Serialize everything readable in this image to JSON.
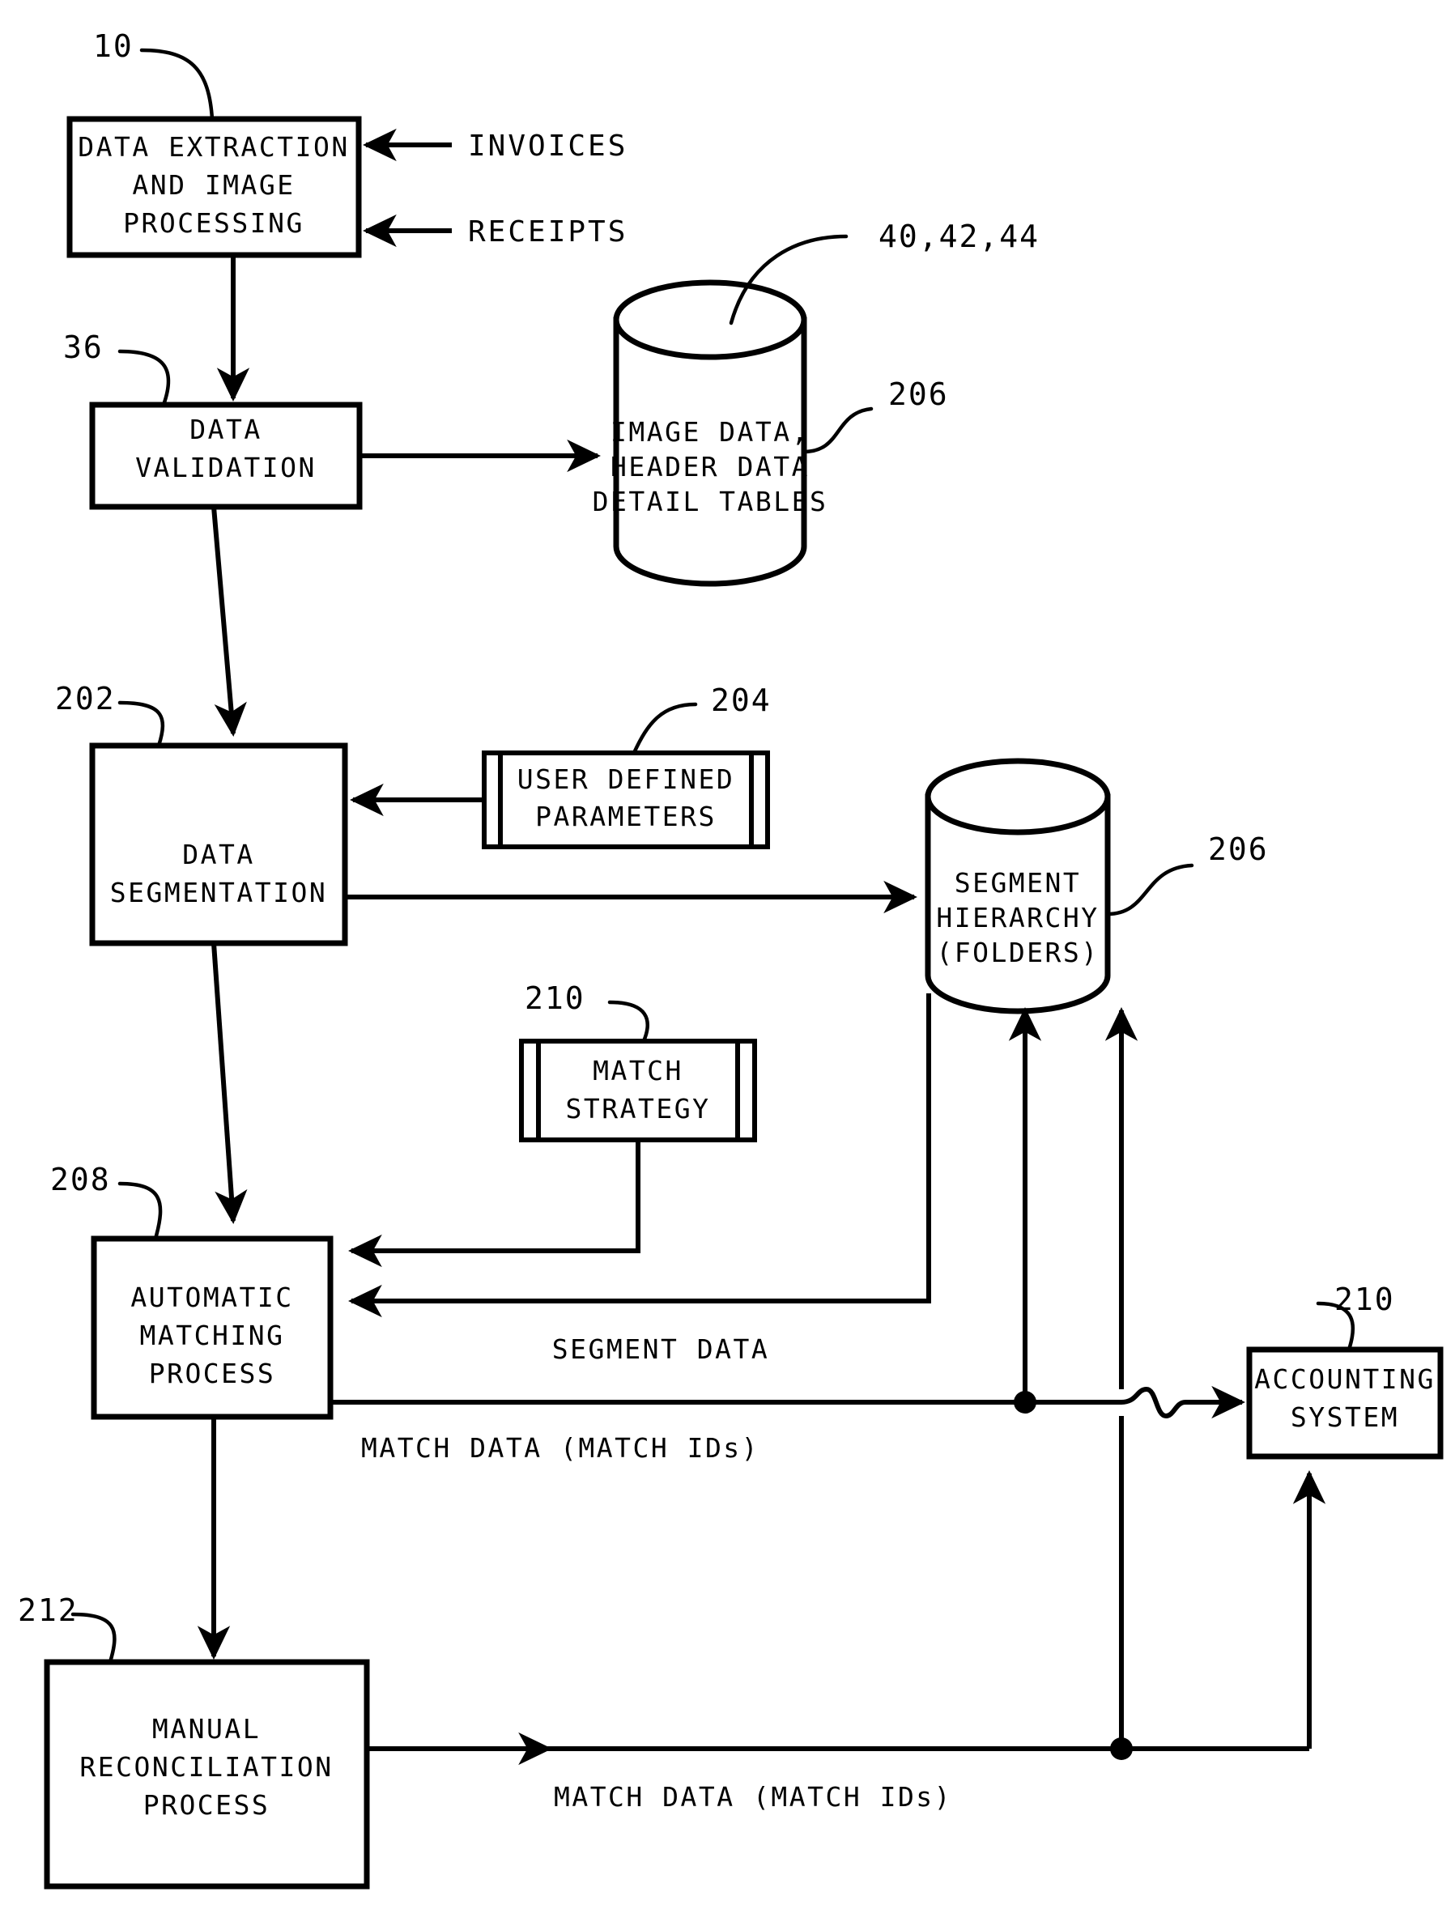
{
  "figure": {
    "title": "Invoice and receipt matching process flow diagram",
    "type": "patent-flowchart",
    "line_color": "#000000",
    "background_color": "#ffffff"
  },
  "nodes": {
    "data_extraction": {
      "ref": "10",
      "lines": [
        "DATA EXTRACTION",
        "AND IMAGE",
        "PROCESSING"
      ],
      "shape": "process-box"
    },
    "data_validation": {
      "ref": "36",
      "lines": [
        "DATA",
        "VALIDATION"
      ],
      "shape": "process-box"
    },
    "image_data_store": {
      "ref": "40,42,44",
      "ref2": "206",
      "lines": [
        "IMAGE DATA,",
        "HEADER DATA",
        "DETAIL TABLES"
      ],
      "shape": "cylinder"
    },
    "data_segmentation": {
      "ref": "202",
      "lines": [
        "DATA",
        "SEGMENTATION"
      ],
      "shape": "process-box"
    },
    "user_defined_parameters": {
      "ref": "204",
      "lines": [
        "USER DEFINED",
        "PARAMETERS"
      ],
      "shape": "stored-data-box"
    },
    "segment_hierarchy": {
      "ref": "206",
      "lines": [
        "SEGMENT",
        "HIERARCHY",
        "(FOLDERS)"
      ],
      "shape": "cylinder"
    },
    "match_strategy": {
      "ref": "210",
      "lines": [
        "MATCH",
        "STRATEGY"
      ],
      "shape": "stored-data-box"
    },
    "automatic_matching": {
      "ref": "208",
      "lines": [
        "AUTOMATIC",
        "MATCHING",
        "PROCESS"
      ],
      "shape": "process-box"
    },
    "accounting_system": {
      "ref": "210",
      "lines": [
        "ACCOUNTING",
        "SYSTEM"
      ],
      "shape": "process-box"
    },
    "manual_reconciliation": {
      "ref": "212",
      "lines": [
        "MANUAL",
        "RECONCILIATION",
        "PROCESS"
      ],
      "shape": "process-box"
    }
  },
  "inputs": {
    "invoices": "INVOICES",
    "receipts": "RECEIPTS"
  },
  "edge_labels": {
    "segment_data": "SEGMENT DATA",
    "match_data_auto": "MATCH DATA (MATCH IDs)",
    "match_data_manual": "MATCH DATA (MATCH IDs)"
  },
  "chart_data": {
    "type": "diagram",
    "title": "Invoice/receipt data matching process flow",
    "nodes": [
      {
        "id": "10",
        "label": "DATA EXTRACTION AND IMAGE PROCESSING",
        "shape": "box"
      },
      {
        "id": "36",
        "label": "DATA VALIDATION",
        "shape": "box"
      },
      {
        "id": "40,42,44 / 206",
        "label": "IMAGE DATA, HEADER DATA DETAIL TABLES",
        "shape": "cylinder"
      },
      {
        "id": "202",
        "label": "DATA SEGMENTATION",
        "shape": "box"
      },
      {
        "id": "204",
        "label": "USER DEFINED PARAMETERS",
        "shape": "stored-data"
      },
      {
        "id": "206",
        "label": "SEGMENT HIERARCHY (FOLDERS)",
        "shape": "cylinder"
      },
      {
        "id": "210",
        "label": "MATCH STRATEGY",
        "shape": "stored-data"
      },
      {
        "id": "208",
        "label": "AUTOMATIC MATCHING PROCESS",
        "shape": "box"
      },
      {
        "id": "210",
        "label": "ACCOUNTING SYSTEM",
        "shape": "box"
      },
      {
        "id": "212",
        "label": "MANUAL RECONCILIATION PROCESS",
        "shape": "box"
      }
    ],
    "edges": [
      {
        "from": "INVOICES",
        "to": "10",
        "label": ""
      },
      {
        "from": "RECEIPTS",
        "to": "10",
        "label": ""
      },
      {
        "from": "10",
        "to": "36",
        "label": ""
      },
      {
        "from": "36",
        "to": "40,42,44",
        "label": ""
      },
      {
        "from": "36",
        "to": "202",
        "label": ""
      },
      {
        "from": "204",
        "to": "202",
        "label": ""
      },
      {
        "from": "202",
        "to": "206",
        "label": ""
      },
      {
        "from": "202",
        "to": "208",
        "label": ""
      },
      {
        "from": "210 (MATCH STRATEGY)",
        "to": "208",
        "label": ""
      },
      {
        "from": "206",
        "to": "208",
        "label": "SEGMENT DATA"
      },
      {
        "from": "208",
        "to": "210 (ACCOUNTING SYSTEM)",
        "label": "MATCH DATA (MATCH IDs)"
      },
      {
        "from": "208",
        "to": "206",
        "label": ""
      },
      {
        "from": "208",
        "to": "212",
        "label": ""
      },
      {
        "from": "212",
        "to": "210 (ACCOUNTING SYSTEM)",
        "label": "MATCH DATA (MATCH IDs)"
      },
      {
        "from": "212",
        "to": "206",
        "label": ""
      }
    ]
  }
}
